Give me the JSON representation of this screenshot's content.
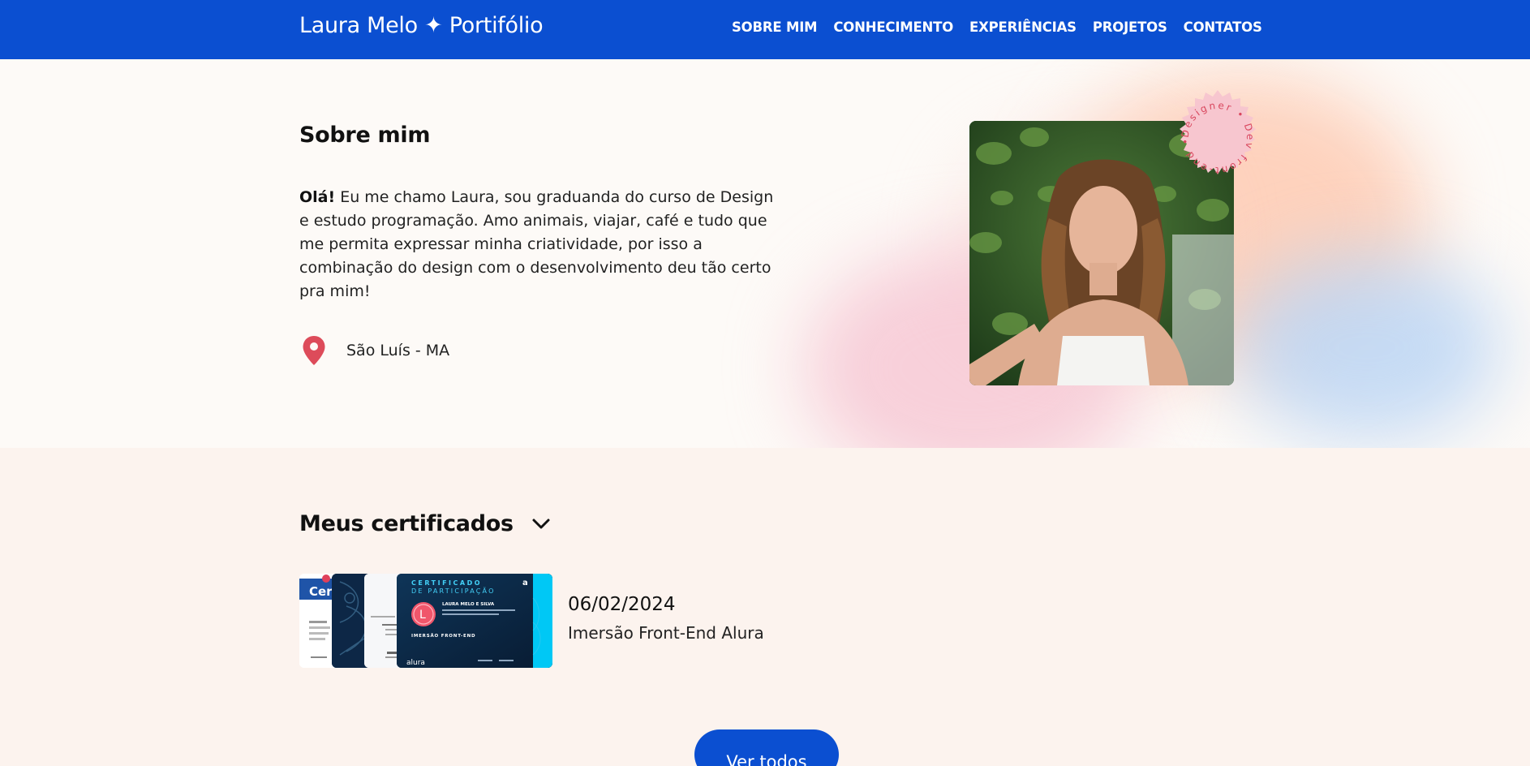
{
  "header": {
    "brand": "Laura Melo ✦ Portifólio",
    "nav": [
      "SOBRE MIM",
      "CONHECIMENTO",
      "EXPERIÊNCIAS",
      "PROJETOS",
      "CONTATOS"
    ]
  },
  "about": {
    "title": "Sobre mim",
    "greeting": "Olá!",
    "text": " Eu me chamo Laura, sou graduanda do curso de Design e estudo programação. Amo animais, viajar, café e tudo que me permita expressar minha criatividade, por isso a combinação do design com o desenvolvimento deu tão certo pra mim!",
    "location": "São Luís - MA",
    "badge_text": "Designer • Dev front-end •",
    "location_icon": "map-pin-icon"
  },
  "certificates": {
    "title": "Meus certificados",
    "toggle_icon": "chevron-down-icon",
    "card_1_text": "Cer",
    "card_4_heading": "CERTIFICADO",
    "card_4_subheading": "DE PARTICIPAÇÃO",
    "card_4_initial": "L",
    "card_4_person": "LAURA MELO E SILVA",
    "card_4_course": "IMERSÃO FRONT-END",
    "card_4_brand": "alura",
    "date": "06/02/2024",
    "name": "Imersão Front-End Alura",
    "view_all": "Ver todos"
  },
  "colors": {
    "primary": "#0b4fd1",
    "pin": "#dd4b5a",
    "badge": "#f7c6cf",
    "badge_text": "#d9475e",
    "card_accent": "#00c8f5"
  }
}
